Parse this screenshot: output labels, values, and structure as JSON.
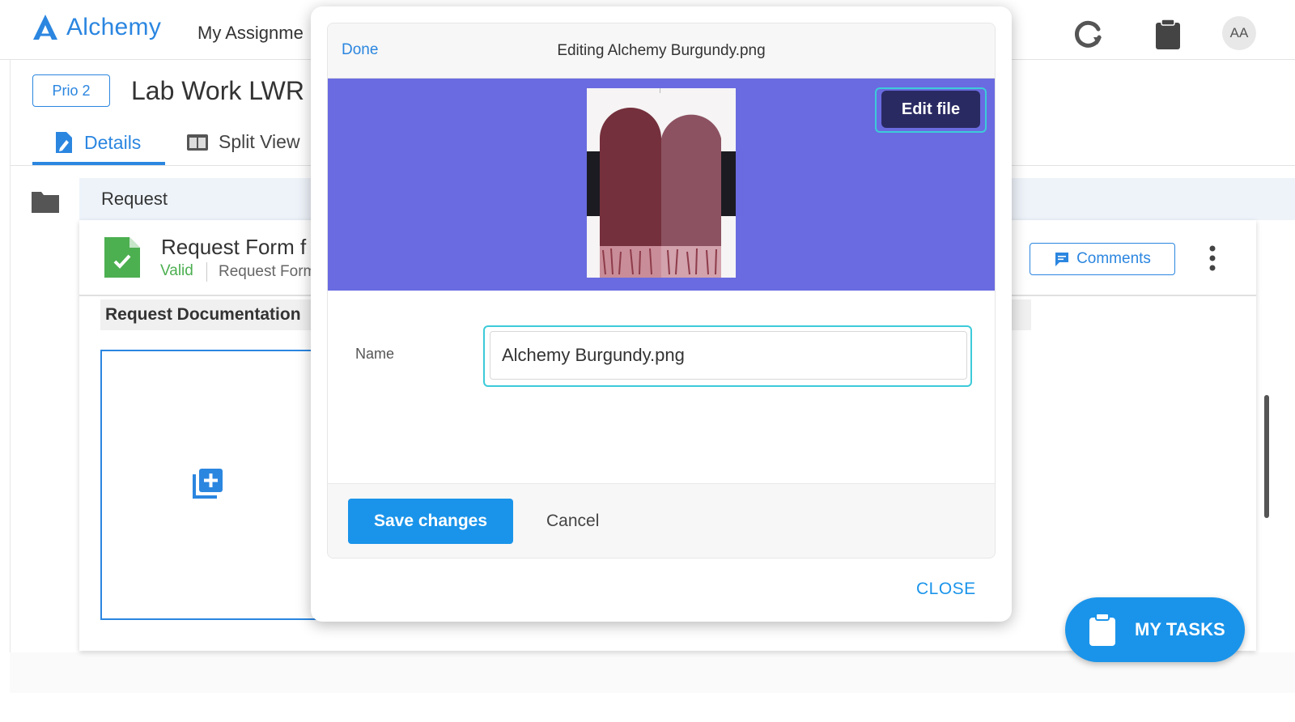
{
  "app": {
    "name": "Alchemy",
    "brand_color": "#2b86e0"
  },
  "topnav": {
    "my_assignments": "My Assignme",
    "avatar_initials": "AA"
  },
  "header": {
    "priority": "Prio 2",
    "title": "Lab Work LWR"
  },
  "tabs": [
    {
      "label": "Details"
    },
    {
      "label": "Split View"
    }
  ],
  "section": {
    "label": "Request"
  },
  "form": {
    "title": "Request Form f",
    "status": "Valid",
    "subtitle": "Request Form",
    "comments_label": "Comments",
    "doc_section_label": "Request Documentation"
  },
  "modal": {
    "done_label": "Done",
    "editing_title": "Editing Alchemy Burgundy.png",
    "edit_file_label": "Edit file",
    "name_label": "Name",
    "name_value": "Alchemy Burgundy.png",
    "save_label": "Save changes",
    "cancel_label": "Cancel",
    "close_label": "CLOSE",
    "preview_bg_color": "#6a6be0"
  },
  "fab": {
    "my_tasks_label": "MY TASKS"
  },
  "colors": {
    "accent": "#1a94ea",
    "valid": "#4caf50",
    "focus_ring": "#3ccbd9"
  }
}
